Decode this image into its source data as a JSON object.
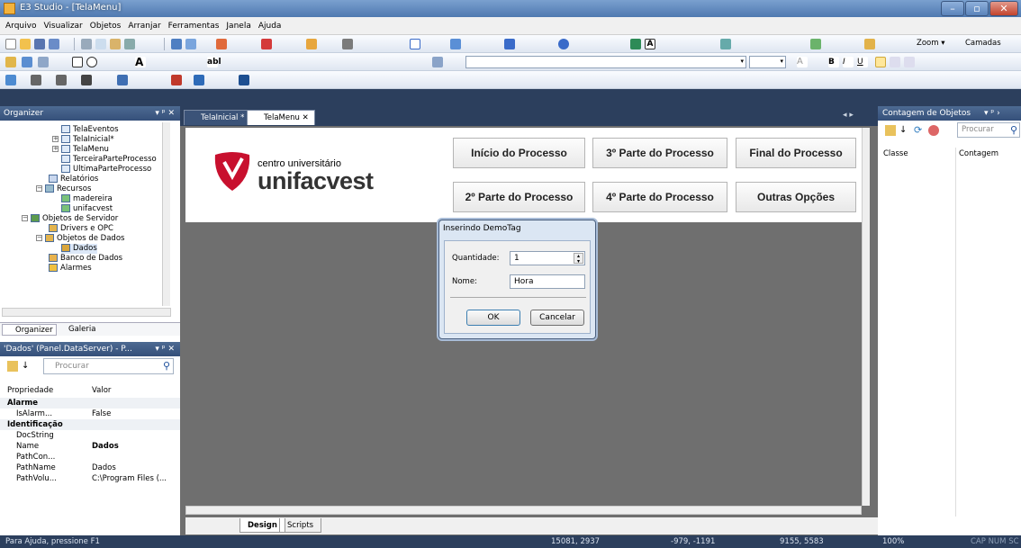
{
  "window": {
    "title": "E3 Studio - [TelaMenu]"
  },
  "menu": [
    "Arquivo",
    "Visualizar",
    "Objetos",
    "Arranjar",
    "Ferramentas",
    "Janela",
    "Ajuda"
  ],
  "toolbar": {
    "zoom_label": "Zoom",
    "layers_label": "Camadas"
  },
  "organizer": {
    "title": "Organizer",
    "tree": [
      {
        "label": "TelaEventos",
        "indent": 3
      },
      {
        "label": "TelaInicial*",
        "indent": 2
      },
      {
        "label": "TelaMenu",
        "indent": 2
      },
      {
        "label": "TerceiraParteProcesso",
        "indent": 3
      },
      {
        "label": "UltimaParteProcesso",
        "indent": 3
      },
      {
        "label": "Relatórios",
        "indent": 2
      },
      {
        "label": "Recursos",
        "indent": 1
      },
      {
        "label": "madereira",
        "indent": 2
      },
      {
        "label": "unifacvest",
        "indent": 2
      },
      {
        "label": "Objetos de Servidor",
        "indent": 0
      },
      {
        "label": "Drivers e OPC",
        "indent": 1
      },
      {
        "label": "Objetos de Dados",
        "indent": 1
      },
      {
        "label": "Dados",
        "indent": 2
      },
      {
        "label": "Banco de Dados",
        "indent": 1
      },
      {
        "label": "Alarmes",
        "indent": 1
      }
    ],
    "tabs": [
      "Organizer",
      "Galeria"
    ]
  },
  "properties": {
    "title": "'Dados' (Panel.DataServer) - P...",
    "search_placeholder": "Procurar",
    "col_prop": "Propriedade",
    "col_value": "Valor",
    "rows": [
      {
        "type": "group",
        "name": "Alarme"
      },
      {
        "type": "row",
        "name": "IsAlarm...",
        "value": "False"
      },
      {
        "type": "group",
        "name": "Identificação"
      },
      {
        "type": "row",
        "name": "DocString",
        "value": ""
      },
      {
        "type": "row",
        "name": "Name",
        "value": "Dados"
      },
      {
        "type": "row",
        "name": "PathCon...",
        "value": ""
      },
      {
        "type": "row",
        "name": "PathName",
        "value": "Dados"
      },
      {
        "type": "row",
        "name": "PathVolu...",
        "value": "C:\\Program Files (..."
      }
    ]
  },
  "doc_tabs": [
    "TelaInicial *",
    "TelaMenu"
  ],
  "screen": {
    "logo_line1": "centro universitário",
    "logo_line2": "unifacvest",
    "buttons": [
      "Início do Processo",
      "3º Parte do Processo",
      "Final do Processo",
      "2º Parte do Processo",
      "4º Parte do Processo",
      "Outras Opções"
    ]
  },
  "bottom_tabs": [
    "Design",
    "Scripts"
  ],
  "dialog": {
    "title": "Inserindo DemoTag",
    "qty_label": "Quantidade:",
    "qty_value": "1",
    "name_label": "Nome:",
    "name_value": "Hora",
    "ok": "OK",
    "cancel": "Cancelar"
  },
  "object_count": {
    "title": "Contagem de Objetos",
    "search_placeholder": "Procurar",
    "col_class": "Classe",
    "col_count": "Contagem"
  },
  "status": {
    "help": "Para Ajuda, pressione F1",
    "pos1": "15081, 2937",
    "pos2": "-979, -1191",
    "pos3": "9155, 5583",
    "zoom": "100%",
    "flags": "CAP NUM SC"
  }
}
